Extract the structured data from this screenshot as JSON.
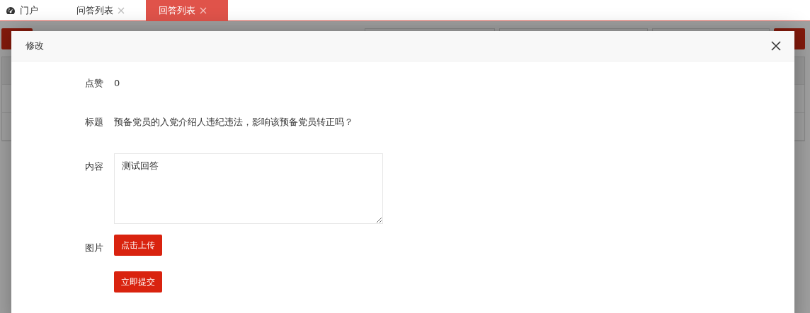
{
  "tabs": [
    {
      "label": "门户",
      "selected": false,
      "kind": "home"
    },
    {
      "label": "问答列表",
      "selected": false,
      "kind": "closable"
    },
    {
      "label": "回答列表",
      "selected": true,
      "kind": "closable"
    }
  ],
  "dialog": {
    "title": "修改",
    "fields": [
      {
        "kind": "text",
        "label": "点赞",
        "value": "0"
      },
      {
        "kind": "text",
        "label": "标题",
        "value": "预备党员的入党介绍人违纪违法，影响该预备党员转正吗？"
      },
      {
        "kind": "textarea",
        "label": "内容",
        "value": "测试回答"
      },
      {
        "kind": "upload",
        "label": "图片",
        "button": "点击上传"
      }
    ],
    "submit": "立即提交"
  }
}
